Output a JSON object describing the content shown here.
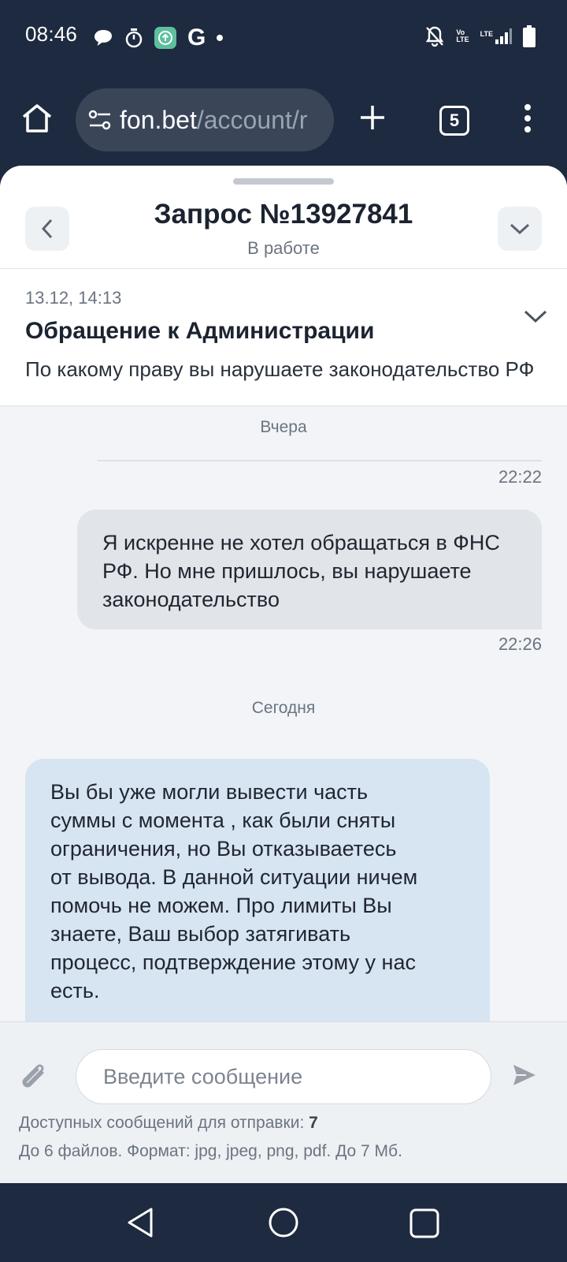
{
  "status_bar": {
    "time": "08:46",
    "google_letter": "G",
    "network_label_top": "Vo\nLTE",
    "network_label_lte": "LTE"
  },
  "browser": {
    "url_host": "fon.bet",
    "url_path": "/account/r",
    "tab_count": "5"
  },
  "request": {
    "title": "Запрос №13927841",
    "status": "В работе"
  },
  "ticket": {
    "date": "13.12, 14:13",
    "subject": "Обращение к Администрации",
    "preview": "По какому праву вы нарушаете законодательство РФ"
  },
  "messages": {
    "day1": "Вчера",
    "time1": "22:22",
    "outgoing_text": "Я искренне не хотел обращаться в ФНС РФ. Но мне пришлось, вы нарушаете законодательство",
    "time2": "22:26",
    "day2": "Сегодня",
    "incoming_text": "Вы бы уже могли вывести часть\nсуммы с  момента , как были сняты\nограничения, но Вы отказываетесь\nот вывода. В данной ситуации ничем\nпомочь не можем. Про лимиты Вы\nзнаете, Ваш выбор затягивать\nпроцесс, подтверждение этому у нас\nесть."
  },
  "compose": {
    "placeholder": "Введите сообщение",
    "quota_label": "Доступных сообщений для отправки: ",
    "quota_count": "7",
    "files_info": "До 6 файлов. Формат: jpg, jpeg, png, pdf. До 7 Мб."
  },
  "colors": {
    "system_bar": "#1e2a3f",
    "incoming_bubble": "#d7e4f2",
    "outgoing_bubble": "#e1e4e9"
  }
}
